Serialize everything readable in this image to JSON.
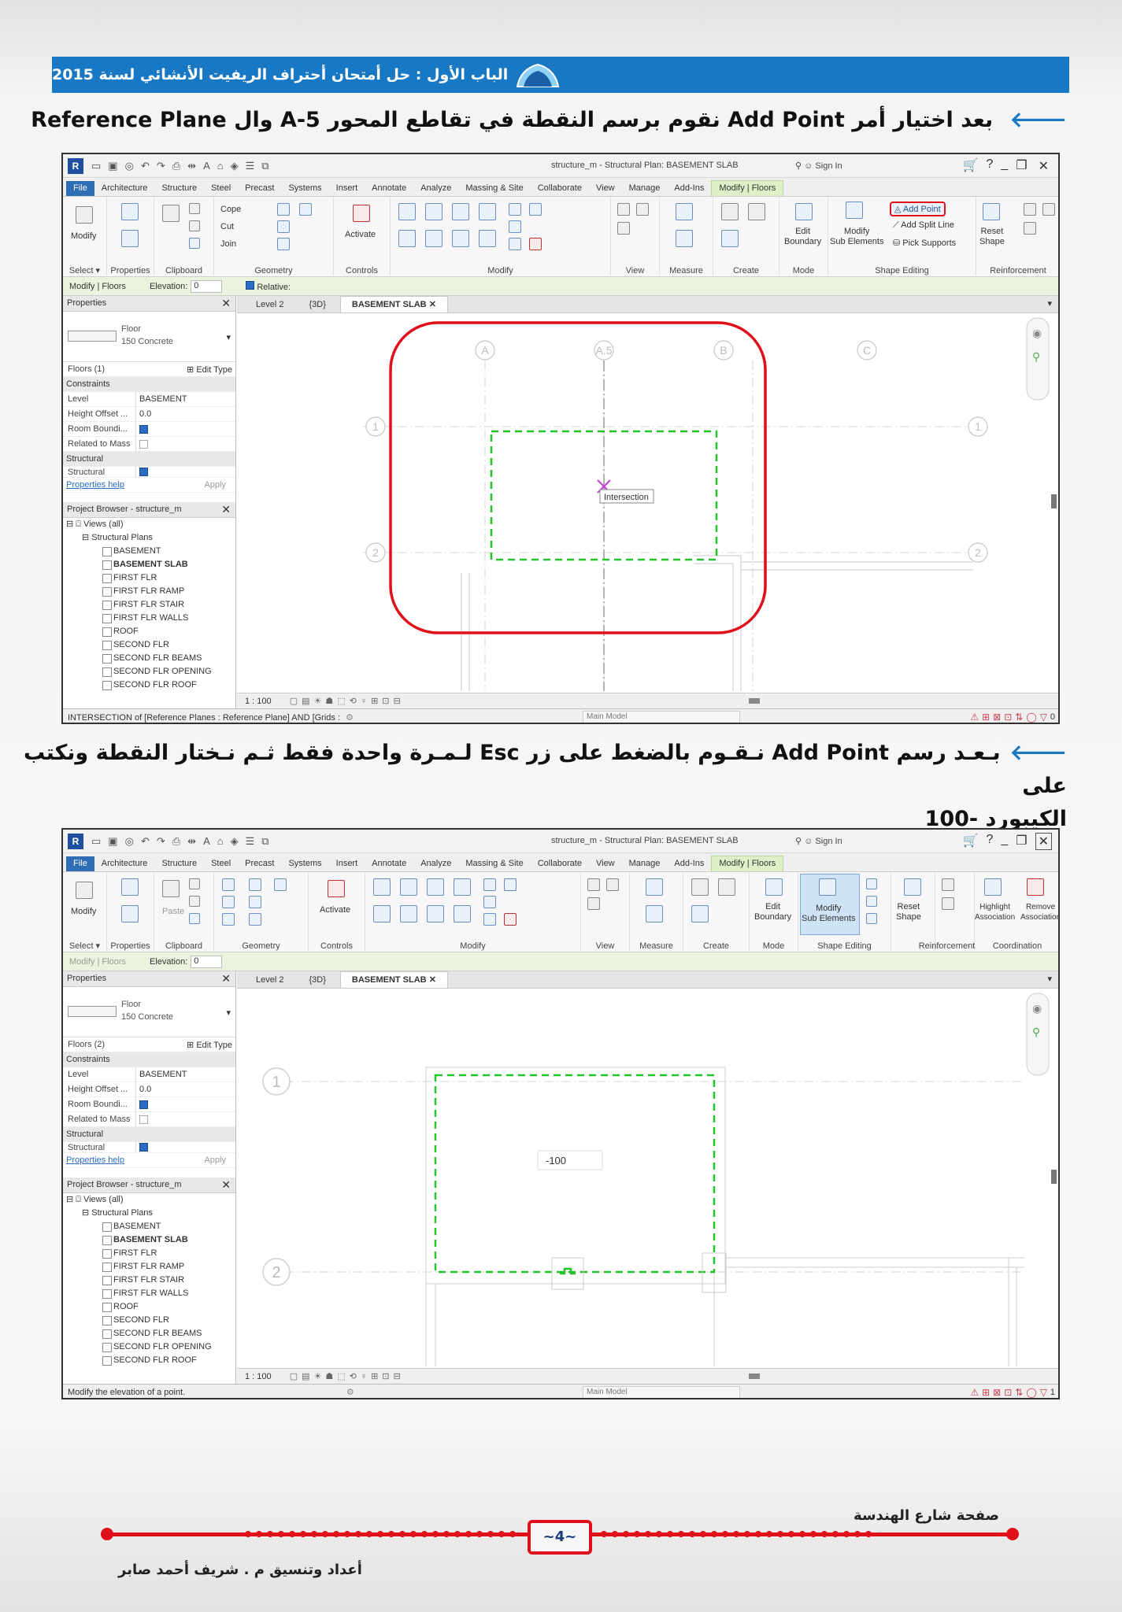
{
  "header": {
    "title": "الباب الأول : حل أمتحان أحتراف الريفيت الأنشائي لسنة 2015"
  },
  "step1": {
    "text": "بعد اختيار أمر Add Point نقوم برسم النقطة في تقاطع المحور A-5 وال Reference Plane"
  },
  "step2": {
    "line1": "بـعـد رسم Add Point نـقـوم بالضغط على زر Esc لـمـرة واحدة فقط ثـم نـختار النقطة ونكتب على",
    "line2": "الكيبورد -100"
  },
  "revit": {
    "window_title": "structure_m - Structural Plan: BASEMENT SLAB",
    "sign_in": "Sign In",
    "tabs": [
      "File",
      "Architecture",
      "Structure",
      "Steel",
      "Precast",
      "Systems",
      "Insert",
      "Annotate",
      "Analyze",
      "Massing & Site",
      "Collaborate",
      "View",
      "Manage",
      "Add-Ins",
      "Modify | Floors"
    ],
    "groups1": [
      "Select ▾",
      "Properties",
      "Clipboard",
      "Geometry",
      "Controls",
      "Modify",
      "View",
      "Measure",
      "Create",
      "Mode",
      "Shape Editing",
      "Reinforcement"
    ],
    "groups2": [
      "Select ▾",
      "Properties",
      "Clipboard",
      "Geometry",
      "Controls",
      "Modify",
      "View",
      "Measure",
      "Create",
      "Mode",
      "Shape Editing",
      "Reinforcement",
      "Coordination"
    ],
    "ribbon": {
      "modify": "Modify",
      "paste": "Paste",
      "cope": "Cope",
      "cut": "Cut",
      "join": "Join",
      "activate": "Activate",
      "edit_boundary": "Edit\nBoundary",
      "modify_sub": "Modify\nSub Elements",
      "add_point": "Add Point",
      "add_split_line": "Add Split Line",
      "pick_supports": "Pick Supports",
      "reset_shape": "Reset\nShape",
      "highlight": "Highlight\nAssociation",
      "remove": "Remove\nAssociation"
    },
    "options_bar": {
      "context": "Modify | Floors",
      "elevation_label": "Elevation:",
      "elevation_value": "0",
      "relative": "Relative:"
    },
    "properties": {
      "title": "Properties",
      "type_family": "Floor",
      "type_name": "150 Concrete",
      "floors1": "Floors (1)",
      "floors2": "Floors (2)",
      "edit_type": "Edit Type",
      "constraints": "Constraints",
      "level_label": "Level",
      "level_value": "BASEMENT",
      "height_offset_label": "Height Offset ...",
      "height_offset_value": "0.0",
      "room_bounding": "Room Boundi...",
      "related_to_mass": "Related to Mass",
      "structural_section": "Structural",
      "structural_row": "Structural",
      "help": "Properties help",
      "apply": "Apply"
    },
    "browser": {
      "title": "Project Browser - structure_m",
      "views": "Views (all)",
      "plans": "Structural Plans",
      "items": [
        "BASEMENT",
        "BASEMENT SLAB",
        "FIRST FLR",
        "FIRST FLR RAMP",
        "FIRST FLR STAIR",
        "FIRST FLR WALLS",
        "ROOF",
        "SECOND FLR",
        "SECOND FLR BEAMS",
        "SECOND FLR OPENING",
        "SECOND FLR ROOF"
      ]
    },
    "view_tabs": [
      "Level 2",
      "{3D}",
      "BASEMENT SLAB"
    ],
    "scale": "1 : 100",
    "grid": {
      "a": "A",
      "a5": "A.5",
      "b": "B",
      "c": "C",
      "one": "1",
      "two": "2"
    },
    "tooltip": "Intersection",
    "elevation_input": "-100",
    "status1": "INTERSECTION  of [Reference Planes : Reference Plane] AND [Grids :",
    "status2": "Modify the elevation of a point.",
    "main_model": "Main Model",
    "filter_count1": "0",
    "filter_count2": "1"
  },
  "footer": {
    "page": "~4~",
    "site": "صفحة شارع الهندسة",
    "author": "أعداد وتنسيق م . شريف أحمد صابر"
  },
  "colors": {
    "banner": "#1878c4",
    "accent_red": "#e10f1a",
    "dashed_green": "#22c42a"
  }
}
